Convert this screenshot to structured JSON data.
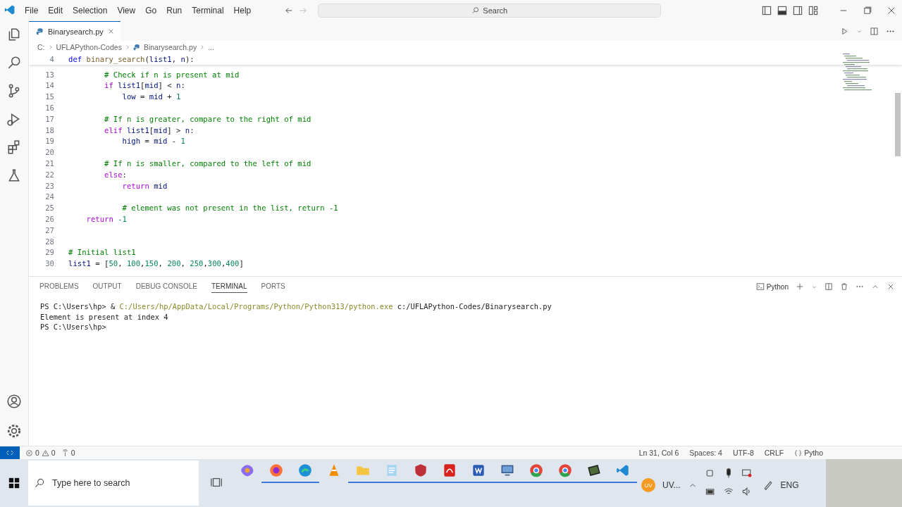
{
  "title_bar": {
    "menu": [
      "File",
      "Edit",
      "Selection",
      "View",
      "Go",
      "Run",
      "Terminal",
      "Help"
    ],
    "search": "Search"
  },
  "tabs": [
    {
      "label": "Binarysearch.py",
      "selected": true
    }
  ],
  "breadcrumb": [
    "C:",
    "UFLAPython-Codes",
    "Binarysearch.py",
    "..."
  ],
  "sticky_line": {
    "number": "4",
    "segments": [
      {
        "kind": "def",
        "text": "def "
      },
      {
        "kind": "fn",
        "text": "binary_search"
      },
      {
        "kind": "plain",
        "text": "("
      },
      {
        "kind": "var",
        "text": "list1"
      },
      {
        "kind": "plain",
        "text": ", "
      },
      {
        "kind": "var",
        "text": "n"
      },
      {
        "kind": "plain",
        "text": "):"
      }
    ]
  },
  "code_lines": [
    {
      "number": "13",
      "segments": [
        {
          "kind": "comment",
          "text": "        # Check if n is present at mid"
        }
      ]
    },
    {
      "number": "14",
      "segments": [
        {
          "kind": "kw",
          "text": "        if "
        },
        {
          "kind": "var",
          "text": "list1"
        },
        {
          "kind": "plain",
          "text": "["
        },
        {
          "kind": "var",
          "text": "mid"
        },
        {
          "kind": "plain",
          "text": "] < "
        },
        {
          "kind": "var",
          "text": "n"
        },
        {
          "kind": "plain",
          "text": ":"
        }
      ]
    },
    {
      "number": "15",
      "segments": [
        {
          "kind": "var",
          "text": "            low"
        },
        {
          "kind": "plain",
          "text": " = "
        },
        {
          "kind": "var",
          "text": "mid"
        },
        {
          "kind": "plain",
          "text": " + "
        },
        {
          "kind": "num",
          "text": "1"
        }
      ]
    },
    {
      "number": "16"
    },
    {
      "number": "17",
      "segments": [
        {
          "kind": "comment",
          "text": "        # If n is greater, compare to the right of mid"
        }
      ]
    },
    {
      "number": "18",
      "segments": [
        {
          "kind": "kw",
          "text": "        elif "
        },
        {
          "kind": "var",
          "text": "list1"
        },
        {
          "kind": "plain",
          "text": "["
        },
        {
          "kind": "var",
          "text": "mid"
        },
        {
          "kind": "plain",
          "text": "] > "
        },
        {
          "kind": "var",
          "text": "n"
        },
        {
          "kind": "plain",
          "text": ":"
        }
      ]
    },
    {
      "number": "19",
      "segments": [
        {
          "kind": "var",
          "text": "            high"
        },
        {
          "kind": "plain",
          "text": " = "
        },
        {
          "kind": "var",
          "text": "mid"
        },
        {
          "kind": "plain",
          "text": " - "
        },
        {
          "kind": "num",
          "text": "1"
        }
      ]
    },
    {
      "number": "20"
    },
    {
      "number": "21",
      "segments": [
        {
          "kind": "comment",
          "text": "        # If n is smaller, compared to the left of mid"
        }
      ]
    },
    {
      "number": "22",
      "segments": [
        {
          "kind": "kw",
          "text": "        else"
        },
        {
          "kind": "plain",
          "text": ":"
        }
      ]
    },
    {
      "number": "23",
      "segments": [
        {
          "kind": "kw",
          "text": "            return "
        },
        {
          "kind": "var",
          "text": "mid"
        }
      ]
    },
    {
      "number": "24"
    },
    {
      "number": "25",
      "segments": [
        {
          "kind": "comment",
          "text": "            # element was not present in the list, return -1"
        }
      ]
    },
    {
      "number": "26",
      "segments": [
        {
          "kind": "kw",
          "text": "    return "
        },
        {
          "kind": "num",
          "text": "-1"
        }
      ]
    },
    {
      "number": "27"
    },
    {
      "number": "28"
    },
    {
      "number": "29",
      "segments": [
        {
          "kind": "comment",
          "text": "# Initial list1"
        }
      ]
    },
    {
      "number": "30",
      "segments": [
        {
          "kind": "var",
          "text": "list1"
        },
        {
          "kind": "plain",
          "text": " = ["
        },
        {
          "kind": "num",
          "text": "50"
        },
        {
          "kind": "plain",
          "text": ", "
        },
        {
          "kind": "num",
          "text": "100"
        },
        {
          "kind": "plain",
          "text": ","
        },
        {
          "kind": "num",
          "text": "150"
        },
        {
          "kind": "plain",
          "text": ", "
        },
        {
          "kind": "num",
          "text": "200"
        },
        {
          "kind": "plain",
          "text": ", "
        },
        {
          "kind": "num",
          "text": "250"
        },
        {
          "kind": "plain",
          "text": ","
        },
        {
          "kind": "num",
          "text": "300"
        },
        {
          "kind": "plain",
          "text": ","
        },
        {
          "kind": "num",
          "text": "400"
        },
        {
          "kind": "plain",
          "text": "]"
        }
      ]
    }
  ],
  "panel_tabs": [
    {
      "label": "PROBLEMS",
      "selected": false
    },
    {
      "label": "OUTPUT",
      "selected": false
    },
    {
      "label": "DEBUG CONSOLE",
      "selected": false
    },
    {
      "label": "TERMINAL",
      "selected": true
    },
    {
      "label": "PORTS",
      "selected": false
    }
  ],
  "terminal_selector": "Python",
  "terminal_lines": [
    {
      "segments": [
        {
          "kind": "plain",
          "text": "PS C:\\Users\\hp> & "
        },
        {
          "kind": "path",
          "text": "C:/Users/hp/AppData/Local/Programs/Python/Python313/python.exe"
        },
        {
          "kind": "plain",
          "text": " c:/UFLAPython-Codes/Binarysearch.py"
        }
      ]
    },
    {
      "segments": [
        {
          "kind": "plain",
          "text": "Element is present at index 4"
        }
      ]
    },
    {
      "segments": [
        {
          "kind": "plain",
          "text": "PS C:\\Users\\hp>"
        }
      ]
    }
  ],
  "status_bar": {
    "errors": "0",
    "warnings": "0",
    "ports": "0",
    "items": [
      "Ln 31, Col 6",
      "Spaces: 4",
      "UTF-8",
      "CRLF",
      "Pytho"
    ]
  },
  "taskbar": {
    "search_placeholder": "Type here to search",
    "apps": [
      {
        "kind": "copilot",
        "running": false
      },
      {
        "kind": "firefox",
        "running": true
      },
      {
        "kind": "edge",
        "running": true
      },
      {
        "kind": "vlc",
        "running": false
      },
      {
        "kind": "folder",
        "running": true
      },
      {
        "kind": "notepad",
        "running": true
      },
      {
        "kind": "badge",
        "running": true
      },
      {
        "kind": "pdf",
        "running": true
      },
      {
        "kind": "word",
        "running": true
      },
      {
        "kind": "monitor",
        "running": true
      },
      {
        "kind": "chrome",
        "running": true
      },
      {
        "kind": "chrome",
        "running": true
      },
      {
        "kind": "chip",
        "running": true
      },
      {
        "kind": "vscode",
        "running": true
      }
    ],
    "user": "UV...",
    "user_initials": "UV",
    "language": "ENG"
  }
}
